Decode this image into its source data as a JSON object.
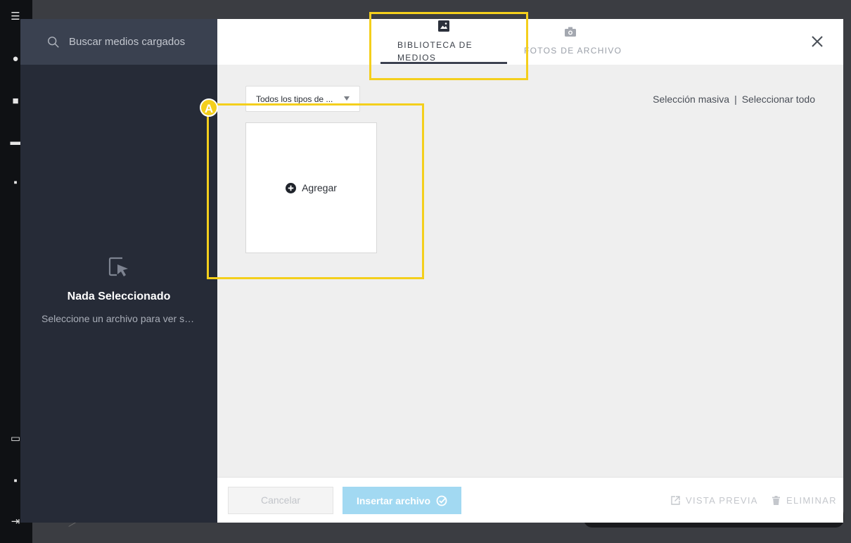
{
  "colors": {
    "accent_highlight": "#f4cf1c",
    "sidebar_bg": "#262b37",
    "search_bg": "#3a4150",
    "insert_button_bg": "#a2d9f2",
    "content_bg": "#efefef"
  },
  "search": {
    "placeholder": "Buscar medios cargados",
    "icon": "search-icon"
  },
  "empty_state": {
    "icon": "cursor-select-icon",
    "title": "Nada Seleccionado",
    "subtitle": "Seleccione un archivo para ver sus detalles"
  },
  "tabs": [
    {
      "label": "BIBLIOTECA DE MEDIOS",
      "icon": "image-icon",
      "active": true
    },
    {
      "label": "FOTOS DE ARCHIVO",
      "icon": "camera-icon",
      "active": false
    }
  ],
  "toolbar": {
    "type_filter": "Todos los tipos de ...",
    "bulk_select": "Selección masiva",
    "separator": "|",
    "select_all": "Seleccionar todo"
  },
  "add_tile": {
    "label": "Agregar",
    "icon": "plus-circle-icon"
  },
  "annotation": {
    "badge": "A"
  },
  "footer": {
    "cancel": "Cancelar",
    "insert": "Insertar archivo",
    "preview": "VISTA PREVIA",
    "delete": "ELIMINAR"
  }
}
